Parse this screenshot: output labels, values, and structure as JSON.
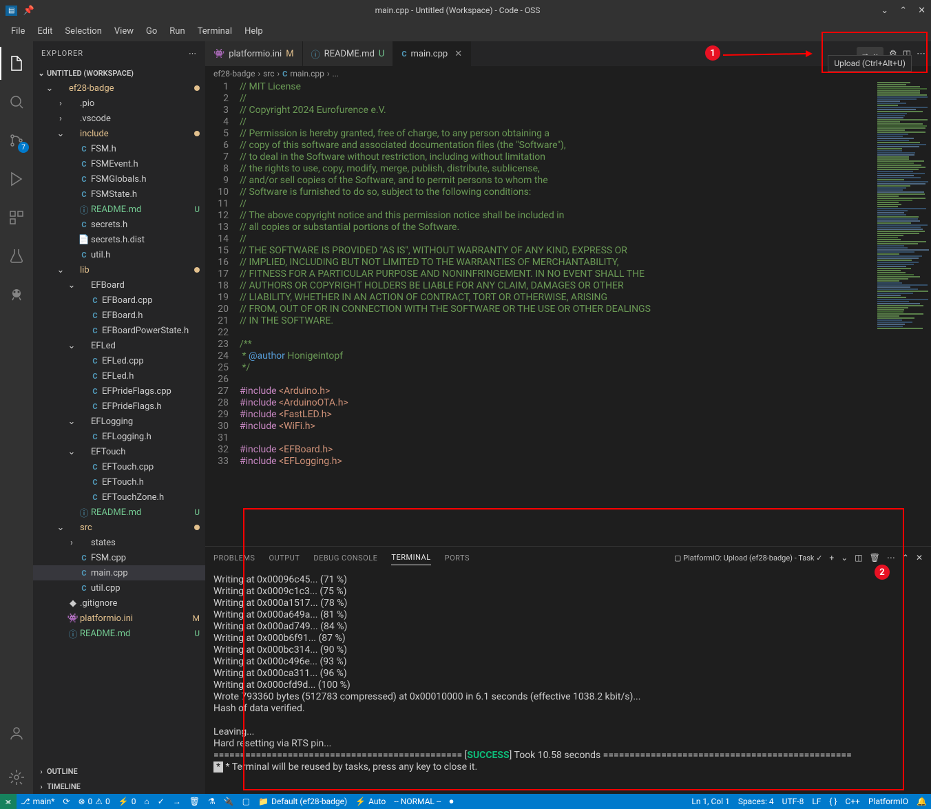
{
  "titlebar": {
    "title": "main.cpp - Untitled (Workspace) - Code - OSS"
  },
  "menubar": [
    "File",
    "Edit",
    "Selection",
    "View",
    "Go",
    "Run",
    "Terminal",
    "Help"
  ],
  "sidebar": {
    "header": "EXPLORER",
    "workspace": "UNTITLED (WORKSPACE)",
    "outline": "OUTLINE",
    "timeline": "TIMELINE",
    "tree": [
      {
        "d": 1,
        "t": "folder-open",
        "n": "ef28-badge",
        "s": "dot-mod",
        "cls": "status-M"
      },
      {
        "d": 2,
        "t": "folder",
        "n": ".pio"
      },
      {
        "d": 2,
        "t": "folder",
        "n": ".vscode"
      },
      {
        "d": 2,
        "t": "folder-open",
        "n": "include",
        "s": "dot-mod",
        "cls": "status-M"
      },
      {
        "d": 3,
        "t": "c",
        "n": "FSM.h"
      },
      {
        "d": 3,
        "t": "c",
        "n": "FSMEvent.h"
      },
      {
        "d": 3,
        "t": "c",
        "n": "FSMGlobals.h"
      },
      {
        "d": 3,
        "t": "c",
        "n": "FSMState.h"
      },
      {
        "d": 3,
        "t": "readme",
        "n": "README.md",
        "s": "U",
        "cls": "status-U"
      },
      {
        "d": 3,
        "t": "c",
        "n": "secrets.h"
      },
      {
        "d": 3,
        "t": "file",
        "n": "secrets.h.dist"
      },
      {
        "d": 3,
        "t": "c",
        "n": "util.h"
      },
      {
        "d": 2,
        "t": "folder-open",
        "n": "lib",
        "s": "dot-mod",
        "cls": "status-M"
      },
      {
        "d": 3,
        "t": "folder-open",
        "n": "EFBoard"
      },
      {
        "d": 4,
        "t": "cpp",
        "n": "EFBoard.cpp"
      },
      {
        "d": 4,
        "t": "c",
        "n": "EFBoard.h"
      },
      {
        "d": 4,
        "t": "c",
        "n": "EFBoardPowerState.h"
      },
      {
        "d": 3,
        "t": "folder-open",
        "n": "EFLed"
      },
      {
        "d": 4,
        "t": "cpp",
        "n": "EFLed.cpp"
      },
      {
        "d": 4,
        "t": "c",
        "n": "EFLed.h"
      },
      {
        "d": 4,
        "t": "cpp",
        "n": "EFPrideFlags.cpp"
      },
      {
        "d": 4,
        "t": "c",
        "n": "EFPrideFlags.h"
      },
      {
        "d": 3,
        "t": "folder-open",
        "n": "EFLogging"
      },
      {
        "d": 4,
        "t": "c",
        "n": "EFLogging.h"
      },
      {
        "d": 3,
        "t": "folder-open",
        "n": "EFTouch"
      },
      {
        "d": 4,
        "t": "cpp",
        "n": "EFTouch.cpp"
      },
      {
        "d": 4,
        "t": "c",
        "n": "EFTouch.h"
      },
      {
        "d": 4,
        "t": "c",
        "n": "EFTouchZone.h"
      },
      {
        "d": 3,
        "t": "readme",
        "n": "README.md",
        "s": "U",
        "cls": "status-U"
      },
      {
        "d": 2,
        "t": "folder-open",
        "n": "src",
        "s": "dot-mod",
        "cls": "status-M"
      },
      {
        "d": 3,
        "t": "folder",
        "n": "states"
      },
      {
        "d": 3,
        "t": "cpp",
        "n": "FSM.cpp"
      },
      {
        "d": 3,
        "t": "cpp",
        "n": "main.cpp",
        "selected": true
      },
      {
        "d": 3,
        "t": "cpp",
        "n": "util.cpp"
      },
      {
        "d": 2,
        "t": "git",
        "n": ".gitignore"
      },
      {
        "d": 2,
        "t": "pio",
        "n": "platformio.ini",
        "s": "M",
        "cls": "status-M"
      },
      {
        "d": 2,
        "t": "readme",
        "n": "README.md",
        "s": "U",
        "cls": "status-U"
      }
    ]
  },
  "scm_badge": "7",
  "tabs": [
    {
      "icon": "pio",
      "label": "platformio.ini",
      "status": "M",
      "statusCls": "status-M"
    },
    {
      "icon": "readme",
      "label": "README.md",
      "status": "U",
      "statusCls": "status-U"
    },
    {
      "icon": "cpp",
      "label": "main.cpp",
      "active": true,
      "close": true
    }
  ],
  "tooltip_upload": "Upload (Ctrl+Alt+U)",
  "breadcrumb": [
    "ef28-badge",
    "src",
    "main.cpp",
    "..."
  ],
  "code": [
    {
      "n": 1,
      "h": "<span class='comment'>// MIT License</span>"
    },
    {
      "n": 2,
      "h": "<span class='comment'>//</span>"
    },
    {
      "n": 3,
      "h": "<span class='comment'>// Copyright 2024 Eurofurence e.V.</span>"
    },
    {
      "n": 4,
      "h": "<span class='comment'>//</span>"
    },
    {
      "n": 5,
      "h": "<span class='comment'>// Permission is hereby granted, free of charge, to any person obtaining a</span>"
    },
    {
      "n": 6,
      "h": "<span class='comment'>// copy of this software and associated documentation files (the \"Software\"),</span>"
    },
    {
      "n": 7,
      "h": "<span class='comment'>// to deal in the Software without restriction, including without limitation</span>"
    },
    {
      "n": 8,
      "h": "<span class='comment'>// the rights to use, copy, modify, merge, publish, distribute, sublicense,</span>"
    },
    {
      "n": 9,
      "h": "<span class='comment'>// and/or sell copies of the Software, and to permit persons to whom the</span>"
    },
    {
      "n": 10,
      "h": "<span class='comment'>// Software is furnished to do so, subject to the following conditions:</span>"
    },
    {
      "n": 11,
      "h": "<span class='comment'>//</span>"
    },
    {
      "n": 12,
      "h": "<span class='comment'>// The above copyright notice and this permission notice shall be included in</span>"
    },
    {
      "n": 13,
      "h": "<span class='comment'>// all copies or substantial portions of the Software.</span>"
    },
    {
      "n": 14,
      "h": "<span class='comment'>//</span>"
    },
    {
      "n": 15,
      "h": "<span class='comment'>// THE SOFTWARE IS PROVIDED \"AS IS\", WITHOUT WARRANTY OF ANY KIND, EXPRESS OR</span>"
    },
    {
      "n": 16,
      "h": "<span class='comment'>// IMPLIED, INCLUDING BUT NOT LIMITED TO THE WARRANTIES OF MERCHANTABILITY,</span>"
    },
    {
      "n": 17,
      "h": "<span class='comment'>// FITNESS FOR A PARTICULAR PURPOSE AND NONINFRINGEMENT. IN NO EVENT SHALL THE</span>"
    },
    {
      "n": 18,
      "h": "<span class='comment'>// AUTHORS OR COPYRIGHT HOLDERS BE LIABLE FOR ANY CLAIM, DAMAGES OR OTHER</span>"
    },
    {
      "n": 19,
      "h": "<span class='comment'>// LIABILITY, WHETHER IN AN ACTION OF CONTRACT, TORT OR OTHERWISE, ARISING</span>"
    },
    {
      "n": 20,
      "h": "<span class='comment'>// FROM, OUT OF OR IN CONNECTION WITH THE SOFTWARE OR THE USE OR OTHER DEALINGS</span>"
    },
    {
      "n": 21,
      "h": "<span class='comment'>// IN THE SOFTWARE.</span>"
    },
    {
      "n": 22,
      "h": ""
    },
    {
      "n": 23,
      "h": "<span class='comment'>/**</span>"
    },
    {
      "n": 24,
      "h": "<span class='comment'> * <span class='doctag'>@author</span> Honigeintopf</span>"
    },
    {
      "n": 25,
      "h": "<span class='comment'> */</span>"
    },
    {
      "n": 26,
      "h": ""
    },
    {
      "n": 27,
      "h": "<span class='keyword'>#include</span> <span class='string'>&lt;Arduino.h&gt;</span>"
    },
    {
      "n": 28,
      "h": "<span class='keyword'>#include</span> <span class='string'>&lt;ArduinoOTA.h&gt;</span>"
    },
    {
      "n": 29,
      "h": "<span class='keyword'>#include</span> <span class='string'>&lt;FastLED.h&gt;</span>"
    },
    {
      "n": 30,
      "h": "<span class='keyword'>#include</span> <span class='string'>&lt;WiFi.h&gt;</span>"
    },
    {
      "n": 31,
      "h": ""
    },
    {
      "n": 32,
      "h": "<span class='keyword'>#include</span> <span class='string'>&lt;EFBoard.h&gt;</span>"
    },
    {
      "n": 33,
      "h": "<span class='keyword'>#include</span> <span class='string'>&lt;EFLogging.h&gt;</span>"
    }
  ],
  "panel": {
    "tabs": [
      "PROBLEMS",
      "OUTPUT",
      "DEBUG CONSOLE",
      "TERMINAL",
      "PORTS"
    ],
    "active": "TERMINAL",
    "task": "PlatformIO: Upload (ef28-badge) - Task",
    "lines": [
      "Writing at 0x00096c45... (71 %)",
      "Writing at 0x0009c1c3... (75 %)",
      "Writing at 0x000a1517... (78 %)",
      "Writing at 0x000a649a... (81 %)",
      "Writing at 0x000ad749... (84 %)",
      "Writing at 0x000b6f91... (87 %)",
      "Writing at 0x000bc314... (90 %)",
      "Writing at 0x000c496e... (93 %)",
      "Writing at 0x000ca311... (96 %)",
      "Writing at 0x000cfd9d... (100 %)",
      "Wrote 793360 bytes (512783 compressed) at 0x00010000 in 6.1 seconds (effective 1038.2 kbit/s)...",
      "Hash of data verified.",
      "",
      "Leaving...",
      "Hard resetting via RTS pin..."
    ],
    "success_prefix": "=============================================== [",
    "success_word": "SUCCESS",
    "success_suffix": "] Took 10.58 seconds ===============================================",
    "reuse": " *  Terminal will be reused by tasks, press any key to close it."
  },
  "statusbar": {
    "branch": "main*",
    "sync": "",
    "errors": "0",
    "warnings": "0",
    "ports": "0",
    "env": "Default (ef28-badge)",
    "auto": "Auto",
    "mode": "-- NORMAL --",
    "lncol": "Ln 1, Col 1",
    "spaces": "Spaces: 4",
    "encoding": "UTF-8",
    "eol": "LF",
    "lang": "C++",
    "pio": "PlatformIO"
  },
  "annot": {
    "c1": "1",
    "c2": "2"
  }
}
